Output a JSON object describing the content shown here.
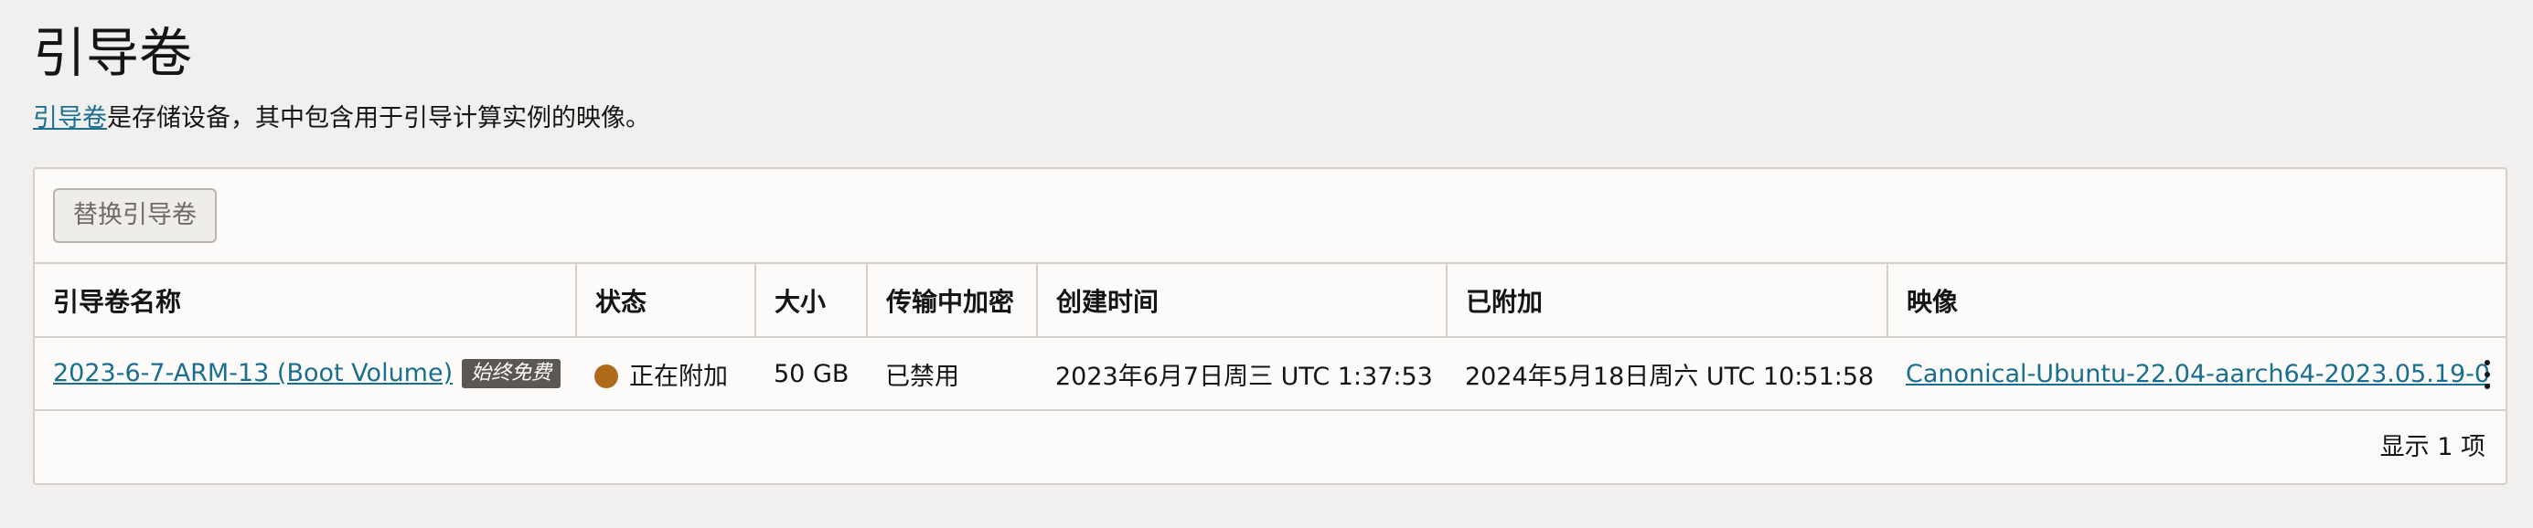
{
  "header": {
    "title": "引导卷",
    "description_link": "引导卷",
    "description_rest": "是存储设备，其中包含用于引导计算实例的映像。"
  },
  "toolbar": {
    "replace_button_label": "替换引导卷"
  },
  "table": {
    "columns": [
      "引导卷名称",
      "状态",
      "大小",
      "传输中加密",
      "创建时间",
      "已附加",
      "映像"
    ],
    "rows": [
      {
        "name": "2023-6-7-ARM-13 (Boot Volume)",
        "badge": "始终免费",
        "status": "正在附加",
        "status_color": "#b06a1c",
        "size": "50 GB",
        "in_transit_encryption": "已禁用",
        "created": "2023年6月7日周三 UTC 1:37:53",
        "attached": "2024年5月18日周六 UTC 10:51:58",
        "image": "Canonical-Ubuntu-22.04-aarch64-2023.05.19-0",
        "actions_icon": "kebab-menu-icon"
      }
    ]
  },
  "footer": {
    "count_label": "显示 1 项"
  },
  "colors": {
    "link": "#1a6e8f",
    "background": "#f1f0ee",
    "panel": "#fcfbfa",
    "border": "#d3d0cb"
  }
}
